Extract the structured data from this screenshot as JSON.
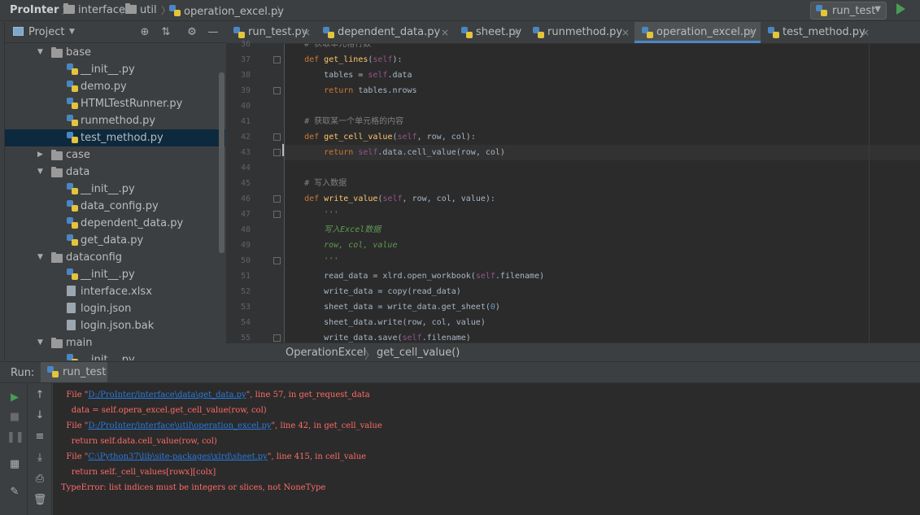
{
  "breadcrumbs": [
    "ProInter",
    "interface",
    "util",
    "operation_excel.py"
  ],
  "run_config": {
    "label": "run_test"
  },
  "project_panel": {
    "title": "Project"
  },
  "tree": [
    {
      "label": "base",
      "type": "folder",
      "depth": 1,
      "expanded": true
    },
    {
      "label": "__init__.py",
      "type": "py",
      "depth": 2
    },
    {
      "label": "demo.py",
      "type": "py",
      "depth": 2
    },
    {
      "label": "HTMLTestRunner.py",
      "type": "py",
      "depth": 2
    },
    {
      "label": "runmethod.py",
      "type": "py",
      "depth": 2
    },
    {
      "label": "test_method.py",
      "type": "py",
      "depth": 2,
      "selected": true
    },
    {
      "label": "case",
      "type": "folder",
      "depth": 1,
      "expanded": false
    },
    {
      "label": "data",
      "type": "folder",
      "depth": 1,
      "expanded": true
    },
    {
      "label": "__init__.py",
      "type": "py",
      "depth": 2
    },
    {
      "label": "data_config.py",
      "type": "py",
      "depth": 2
    },
    {
      "label": "dependent_data.py",
      "type": "py",
      "depth": 2
    },
    {
      "label": "get_data.py",
      "type": "py",
      "depth": 2
    },
    {
      "label": "dataconfig",
      "type": "folder",
      "depth": 1,
      "expanded": true
    },
    {
      "label": "__init__.py",
      "type": "py",
      "depth": 2
    },
    {
      "label": "interface.xlsx",
      "type": "file",
      "depth": 2
    },
    {
      "label": "login.json",
      "type": "file",
      "depth": 2
    },
    {
      "label": "login.json.bak",
      "type": "file",
      "depth": 2
    },
    {
      "label": "main",
      "type": "folder",
      "depth": 1,
      "expanded": true
    },
    {
      "label": "__init__.py",
      "type": "py",
      "depth": 2
    }
  ],
  "tabs": [
    {
      "label": "run_test.py",
      "active": false
    },
    {
      "label": "dependent_data.py",
      "active": false
    },
    {
      "label": "sheet.py",
      "active": false
    },
    {
      "label": "runmethod.py",
      "active": false
    },
    {
      "label": "operation_excel.py",
      "active": true
    },
    {
      "label": "test_method.py",
      "active": false
    }
  ],
  "editor": {
    "current_line": 42,
    "lines": [
      {
        "n": "36",
        "parts": [
          [
            "cm",
            "    # 获取单元格行数"
          ]
        ]
      },
      {
        "n": "37",
        "parts": [
          [
            "kw",
            "    def "
          ],
          [
            "fn",
            "get_lines"
          ],
          [
            "",
            "("
          ],
          [
            "sf",
            "self"
          ],
          [
            "",
            "):"
          ]
        ]
      },
      {
        "n": "38",
        "parts": [
          [
            "",
            "        tables = "
          ],
          [
            "sf",
            "self"
          ],
          [
            "",
            ".data"
          ]
        ]
      },
      {
        "n": "39",
        "parts": [
          [
            "kw",
            "        return "
          ],
          [
            "",
            "tables.nrows"
          ]
        ]
      },
      {
        "n": "40",
        "parts": [
          [
            "",
            ""
          ]
        ]
      },
      {
        "n": "41",
        "parts": [
          [
            "cm",
            "    # 获取某一个单元格的内容"
          ]
        ]
      },
      {
        "n": "42",
        "parts": [
          [
            "kw",
            "    def "
          ],
          [
            "fn",
            "get_cell_value"
          ],
          [
            "",
            "("
          ],
          [
            "sf",
            "self"
          ],
          [
            "",
            ", row, col):"
          ]
        ]
      },
      {
        "n": "43",
        "parts": [
          [
            "kw",
            "        return "
          ],
          [
            "sf",
            "self"
          ],
          [
            "",
            ".data.cell_value(row, col)"
          ]
        ]
      },
      {
        "n": "44",
        "parts": [
          [
            "",
            ""
          ]
        ]
      },
      {
        "n": "45",
        "parts": [
          [
            "cm",
            "    # 写入数据"
          ]
        ]
      },
      {
        "n": "46",
        "parts": [
          [
            "kw",
            "    def "
          ],
          [
            "fn",
            "write_value"
          ],
          [
            "",
            "("
          ],
          [
            "sf",
            "self"
          ],
          [
            "",
            ", row, col, value):"
          ]
        ]
      },
      {
        "n": "47",
        "parts": [
          [
            "doc",
            "        '''"
          ]
        ]
      },
      {
        "n": "48",
        "parts": [
          [
            "doc",
            "        写入Excel数据"
          ]
        ]
      },
      {
        "n": "49",
        "parts": [
          [
            "doc",
            "        row, col, value"
          ]
        ]
      },
      {
        "n": "50",
        "parts": [
          [
            "doc",
            "        '''"
          ]
        ]
      },
      {
        "n": "51",
        "parts": [
          [
            "",
            "        read_data = xlrd.open_workbook("
          ],
          [
            "sf",
            "self"
          ],
          [
            "",
            ".filename)"
          ]
        ]
      },
      {
        "n": "52",
        "parts": [
          [
            "",
            "        write_data = copy(read_data)"
          ]
        ]
      },
      {
        "n": "53",
        "parts": [
          [
            "",
            "        sheet_data = write_data.get_sheet("
          ],
          [
            "num",
            "0"
          ],
          [
            "",
            ")"
          ]
        ]
      },
      {
        "n": "54",
        "parts": [
          [
            "",
            "        sheet_data.write(row, col, value)"
          ]
        ]
      },
      {
        "n": "55",
        "parts": [
          [
            "",
            "        write_data.save("
          ],
          [
            "sf",
            "self"
          ],
          [
            "",
            ".filename)"
          ]
        ]
      }
    ]
  },
  "editor_breadcrumb": [
    "OperationExcel",
    "get_cell_value()"
  ],
  "run_panel": {
    "label": "Run:",
    "tab": "run_test"
  },
  "console": [
    {
      "parts": [
        [
          "",
          "  File \""
        ],
        [
          "lnk",
          "D:/ProInter/interface\\data\\get_data.py"
        ],
        [
          "",
          "\", line 57, in get_request_data"
        ]
      ]
    },
    {
      "parts": [
        [
          "",
          "    data = self.opera_excel.get_cell_value(row, col)"
        ]
      ]
    },
    {
      "parts": [
        [
          "",
          "  File \""
        ],
        [
          "lnk",
          "D:/ProInter/interface\\util\\operation_excel.py"
        ],
        [
          "",
          "\", line 42, in get_cell_value"
        ]
      ]
    },
    {
      "parts": [
        [
          "",
          "    return self.data.cell_value(row, col)"
        ]
      ]
    },
    {
      "parts": [
        [
          "",
          "  File \""
        ],
        [
          "lnk",
          "C:\\Python37\\lib\\site-packages\\xlrd\\sheet.py"
        ],
        [
          "",
          "\", line 415, in cell_value"
        ]
      ]
    },
    {
      "parts": [
        [
          "",
          "    return self._cell_values[rowx][colx]"
        ]
      ]
    },
    {
      "parts": [
        [
          "",
          "TypeError: list indices must be integers or slices, not NoneType"
        ]
      ]
    }
  ]
}
